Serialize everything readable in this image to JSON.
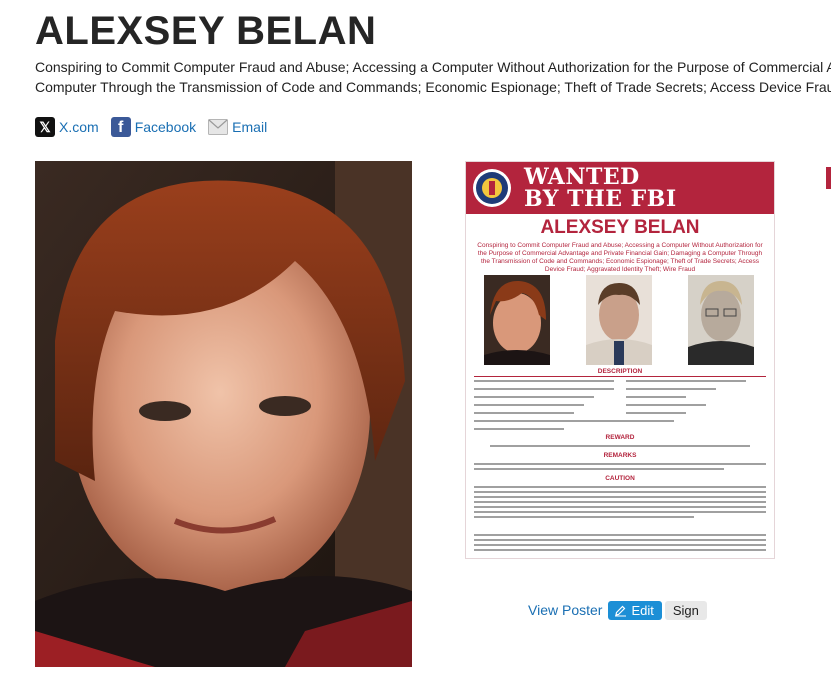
{
  "page": {
    "title": "ALEXSEY BELAN",
    "charges_line1": "Conspiring to Commit Computer Fraud and Abuse; Accessing a Computer Without Authorization for the Purpose of Commercial A",
    "charges_line2": "Computer Through the Transmission of Code and Commands; Economic Espionage; Theft of Trade Secrets; Access Device Frau"
  },
  "share": {
    "x_icon": "x-logo-icon",
    "x_label": "X.com",
    "facebook_icon": "facebook-icon",
    "facebook_label": "Facebook",
    "email_icon": "envelope-icon",
    "email_label": "Email"
  },
  "poster": {
    "header_line1": "WANTED",
    "header_line2": "BY THE FBI",
    "name": "ALEXSEY BELAN",
    "charges": "Conspiring to Commit Computer Fraud and Abuse; Accessing a Computer Without Authorization for the Purpose of Commercial Advantage and Private Financial Gain; Damaging a Computer Through the Transmission of Code and Commands; Economic Espionage; Theft of Trade Secrets; Access Device Fraud; Aggravated Identity Theft; Wire Fraud",
    "section_description": "DESCRIPTION",
    "section_reward": "REWARD",
    "section_remarks": "REMARKS",
    "section_caution": "CAUTION",
    "accent_color": "#b3243d"
  },
  "actions": {
    "view_poster": "View Poster",
    "edit": "Edit",
    "edit_icon": "pencil-icon",
    "sign": "Sign"
  }
}
